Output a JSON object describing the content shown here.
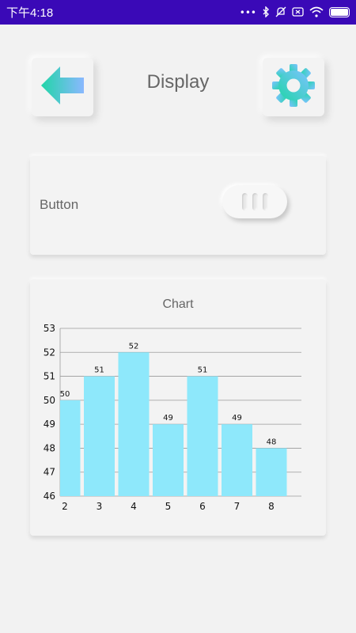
{
  "status": {
    "time": "下午4:18",
    "dots": "•••"
  },
  "header": {
    "title": "Display",
    "back_icon": "back-arrow-icon",
    "settings_icon": "gear-icon"
  },
  "toggle_card": {
    "label": "Button",
    "state": "off"
  },
  "chart_card": {
    "title": "Chart"
  },
  "chart_data": {
    "type": "bar",
    "title": "Chart",
    "categories": [
      "2",
      "3",
      "4",
      "5",
      "6",
      "7",
      "8"
    ],
    "values": [
      50,
      51,
      52,
      49,
      51,
      49,
      48
    ],
    "ylim": [
      46,
      53
    ],
    "yticks": [
      46,
      47,
      48,
      49,
      50,
      51,
      52,
      53
    ],
    "bar_color": "#8ee8fb",
    "grid": true,
    "xlabel": "",
    "ylabel": ""
  },
  "colors": {
    "statusbar": "#3a09b7",
    "accent_start": "#21d5a8",
    "accent_end": "#7cc3ff",
    "text": "#666666"
  }
}
